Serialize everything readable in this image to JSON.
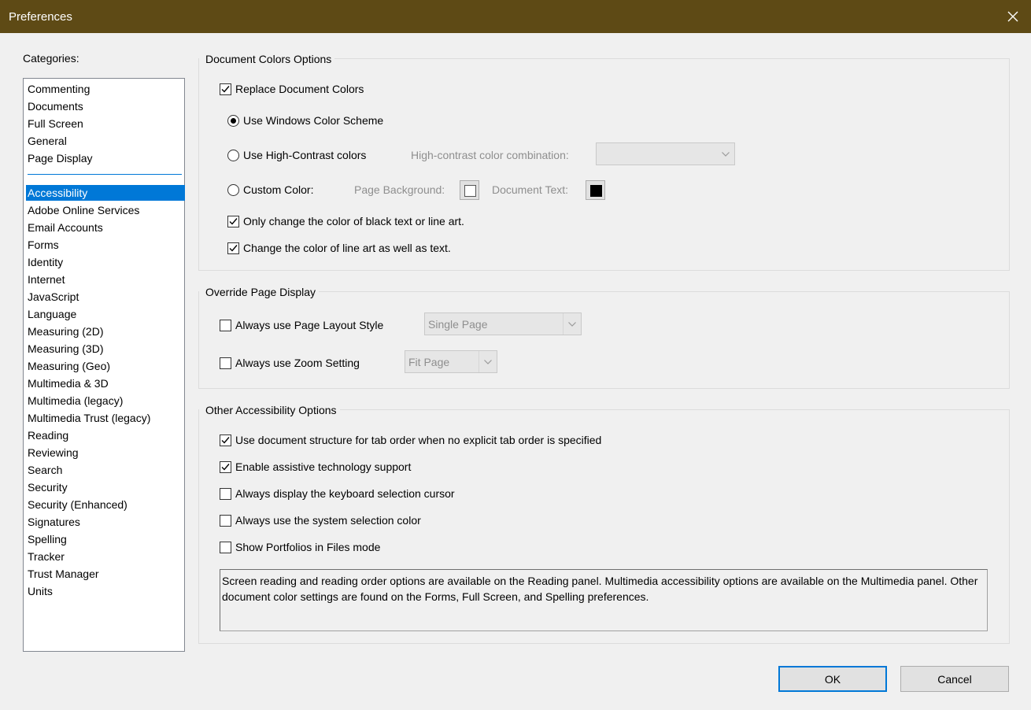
{
  "window": {
    "title": "Preferences"
  },
  "categories": {
    "label": "Categories:",
    "top_items": [
      "Commenting",
      "Documents",
      "Full Screen",
      "General",
      "Page Display"
    ],
    "items": [
      "Accessibility",
      "Adobe Online Services",
      "Email Accounts",
      "Forms",
      "Identity",
      "Internet",
      "JavaScript",
      "Language",
      "Measuring (2D)",
      "Measuring (3D)",
      "Measuring (Geo)",
      "Multimedia & 3D",
      "Multimedia (legacy)",
      "Multimedia Trust (legacy)",
      "Reading",
      "Reviewing",
      "Search",
      "Security",
      "Security (Enhanced)",
      "Signatures",
      "Spelling",
      "Tracker",
      "Trust Manager",
      "Units"
    ],
    "selected": "Accessibility"
  },
  "doc_colors": {
    "title": "Document Colors Options",
    "replace_label": "Replace Document Colors",
    "replace_checked": true,
    "windows_scheme_label": "Use Windows Color Scheme",
    "windows_scheme_selected": true,
    "high_contrast_label": "Use High-Contrast colors",
    "high_contrast_combo_label": "High-contrast color combination:",
    "high_contrast_combo_value": "",
    "custom_label": "Custom Color:",
    "page_bg_label": "Page Background:",
    "page_bg_color": "#ffffff",
    "doc_text_label": "Document Text:",
    "doc_text_color": "#000000",
    "only_black_label": "Only change the color of black text or line art.",
    "only_black_checked": true,
    "line_art_label": "Change the color of line art as well as text.",
    "line_art_checked": true
  },
  "override": {
    "title": "Override Page Display",
    "layout_label": "Always use Page Layout Style",
    "layout_checked": false,
    "layout_value": "Single Page",
    "zoom_label": "Always use Zoom Setting",
    "zoom_checked": false,
    "zoom_value": "Fit Page"
  },
  "other": {
    "title": "Other Accessibility Options",
    "options": [
      {
        "label": "Use document structure for tab order when no explicit tab order is specified",
        "checked": true
      },
      {
        "label": "Enable assistive technology support",
        "checked": true
      },
      {
        "label": "Always display the keyboard selection cursor",
        "checked": false
      },
      {
        "label": "Always use the system selection color",
        "checked": false
      },
      {
        "label": "Show Portfolios in Files mode",
        "checked": false
      }
    ],
    "info": "Screen reading and reading order options are available on the Reading panel. Multimedia accessibility options are available on the Multimedia panel. Other document color settings are found on the Forms, Full Screen, and Spelling preferences."
  },
  "buttons": {
    "ok": "OK",
    "cancel": "Cancel"
  },
  "colors": {
    "titlebar": "#5e4a15",
    "accent": "#0078d7"
  }
}
